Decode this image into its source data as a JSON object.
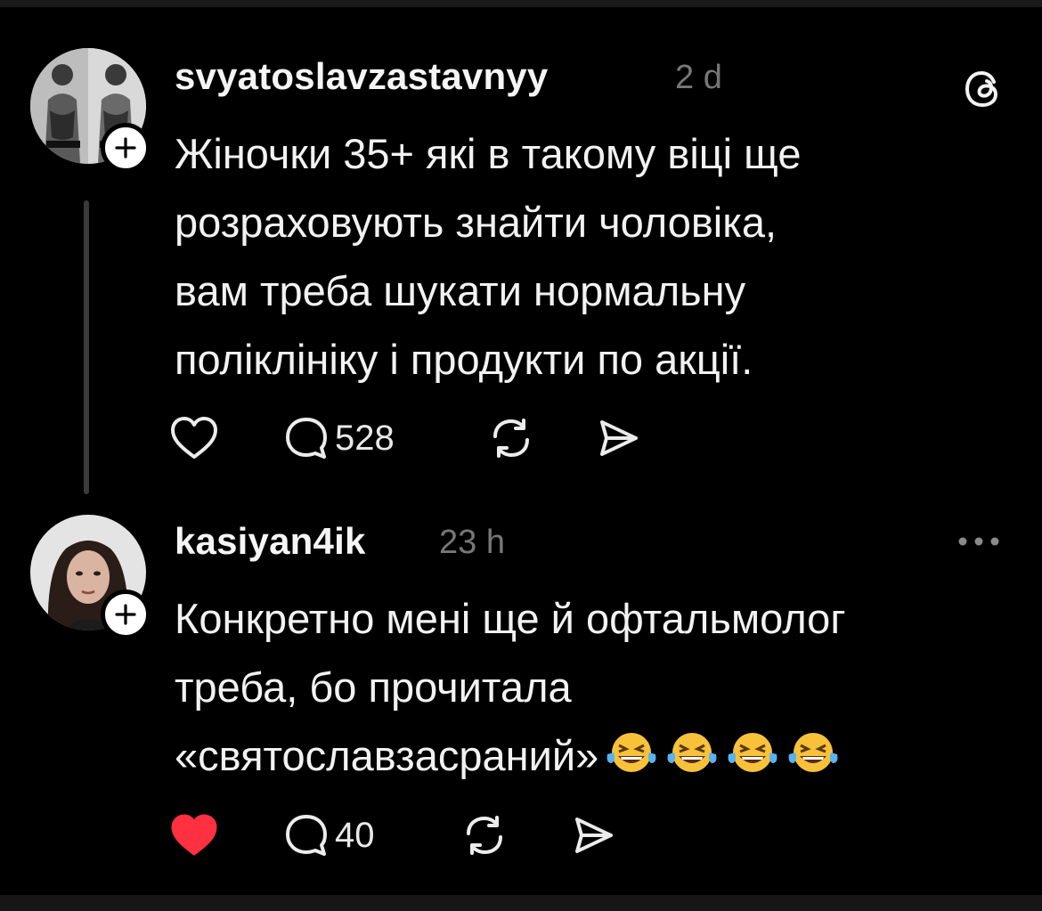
{
  "posts": [
    {
      "username": "svyatoslavzastavnyy",
      "time": "2 d",
      "text": [
        "Жіночки 35+ які в такому віці ще",
        "розраховують знайти чоловіка,",
        "вам треба шукати нормальну",
        "поліклініку і продукти по акції."
      ],
      "liked": false,
      "reply_count": "528",
      "corner_icon": "threads-logo-icon"
    },
    {
      "username": "kasiyan4ik",
      "time": "23 h",
      "text": [
        "Конкретно мені ще й офтальмолог",
        "треба, бо прочитала",
        "«святославзасраний»"
      ],
      "emoji": "😂😂😂😂",
      "liked": true,
      "reply_count": "40",
      "corner_icon": "more-options-icon"
    }
  ],
  "colors": {
    "background": "#000000",
    "like_red": "#ff3040",
    "muted": "#777777"
  }
}
